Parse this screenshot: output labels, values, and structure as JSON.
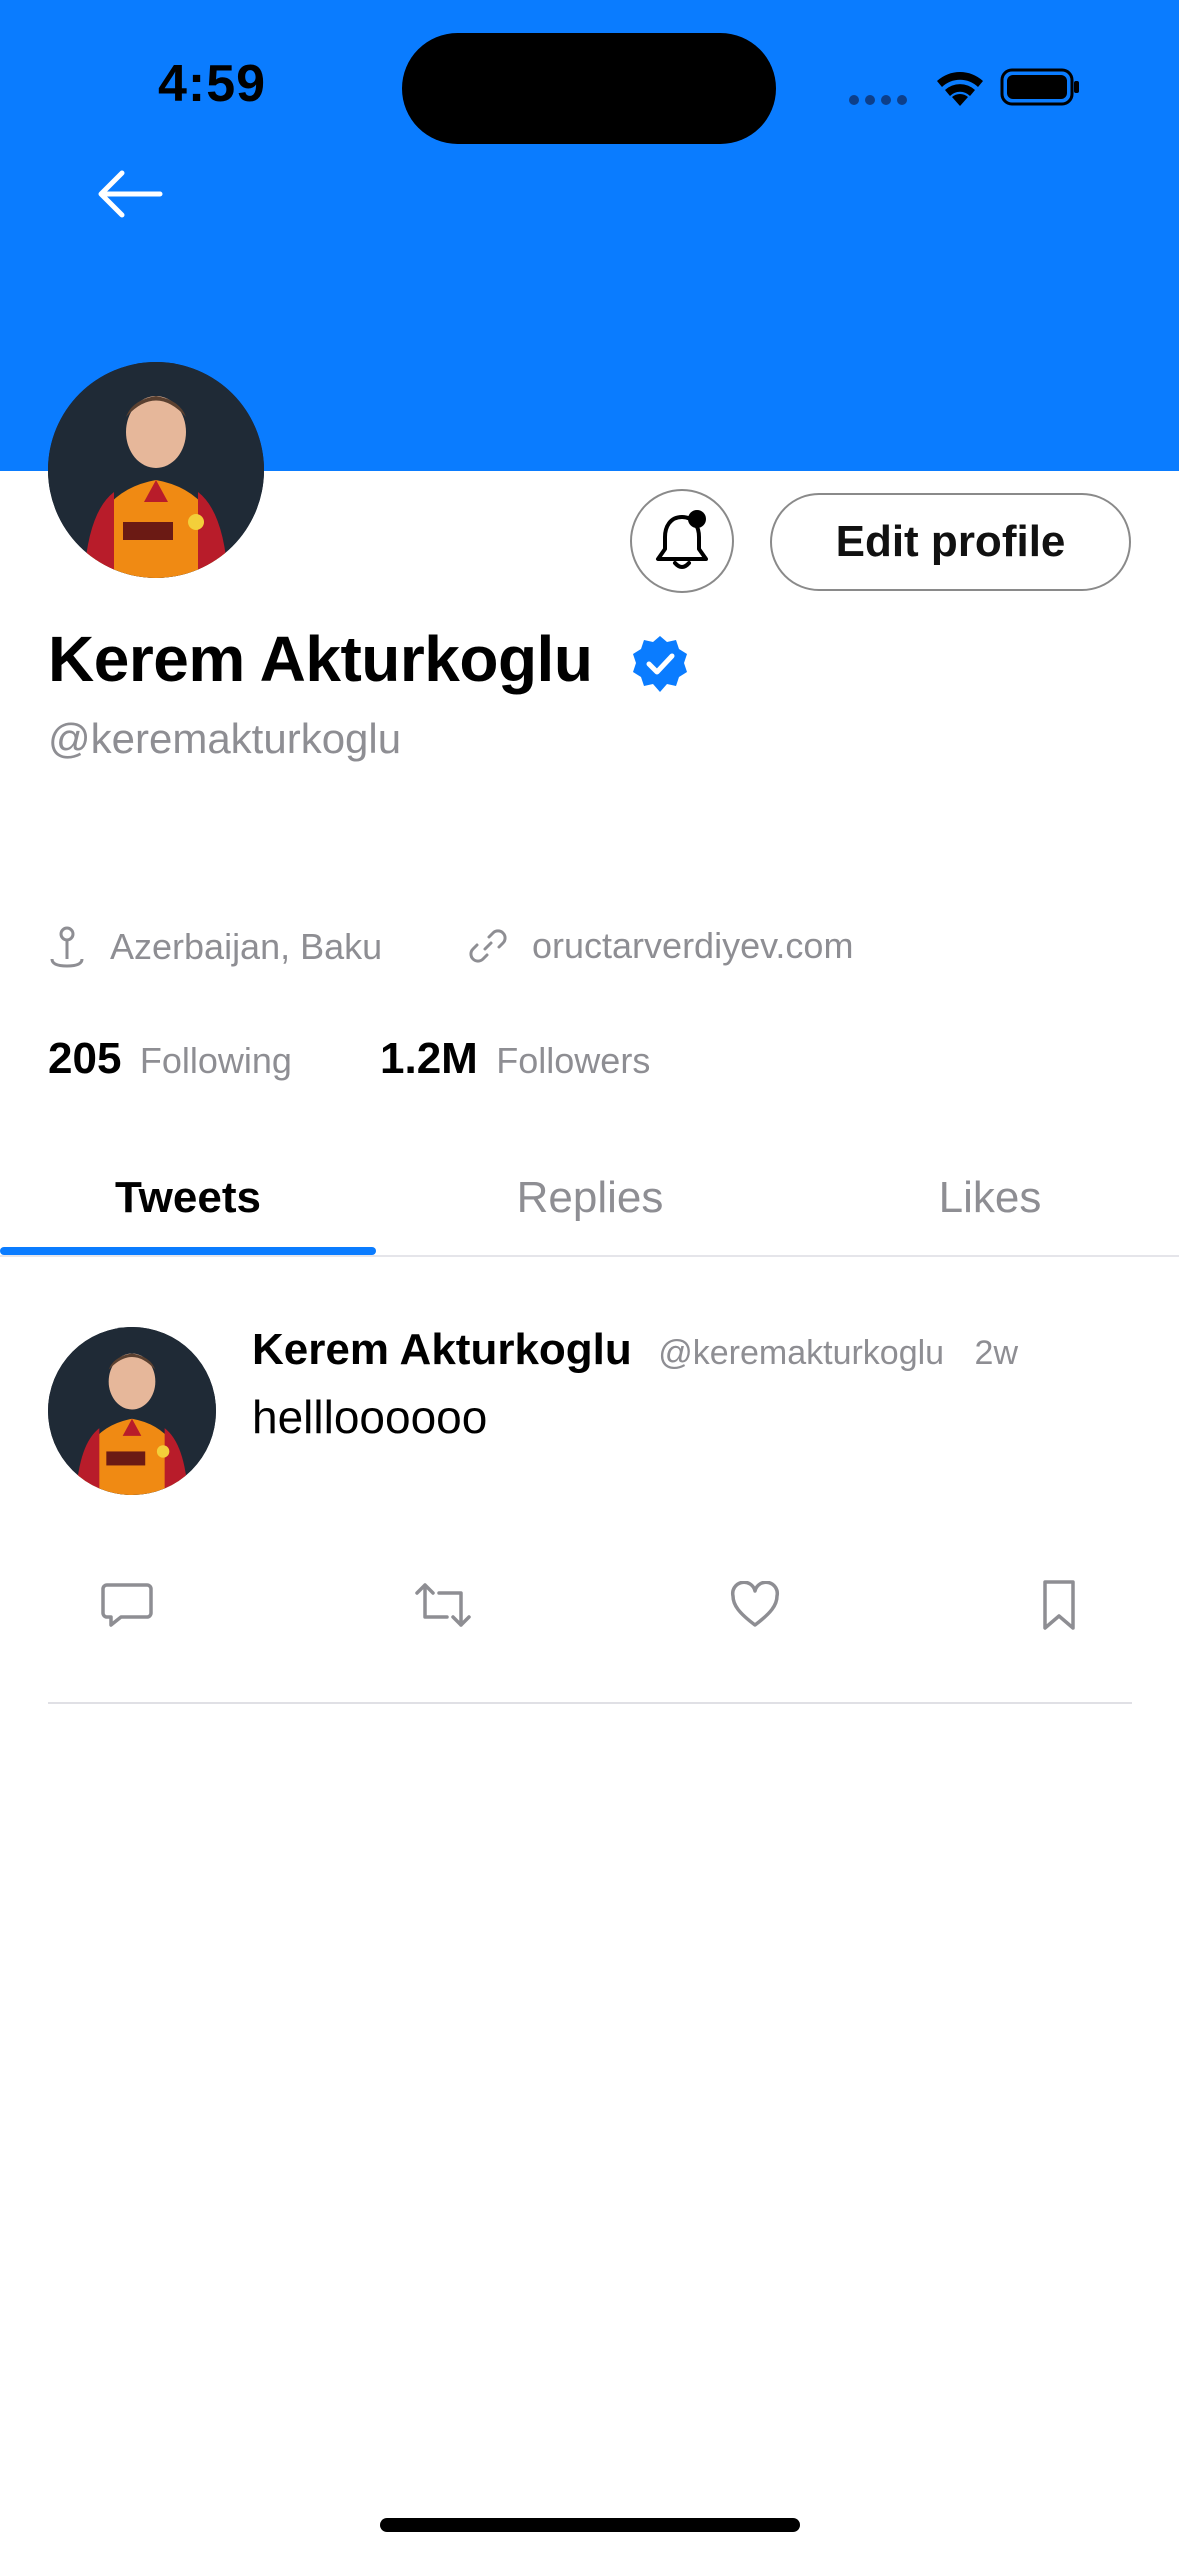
{
  "status_bar": {
    "time": "4:59"
  },
  "header": {
    "banner_color": "#0a7cff",
    "back_icon": "arrow-left-icon"
  },
  "profile": {
    "name": "Kerem Akturkoglu",
    "handle": "@keremakturkoglu",
    "verified": true,
    "edit_label": "Edit profile",
    "location": "Azerbaijan, Baku",
    "website": "oructarverdiyev.com",
    "following_count": "205",
    "following_label": "Following",
    "followers_count": "1.2M",
    "followers_label": "Followers"
  },
  "tabs": [
    {
      "label": "Tweets",
      "active": true
    },
    {
      "label": "Replies",
      "active": false
    },
    {
      "label": "Likes",
      "active": false
    }
  ],
  "tweets": [
    {
      "name": "Kerem Akturkoglu",
      "handle": "@keremakturkoglu",
      "time": "2w",
      "text": "hellloooooo",
      "actions": [
        "comment-icon",
        "retweet-icon",
        "heart-icon",
        "bookmark-icon"
      ]
    }
  ],
  "colors": {
    "accent": "#0a7cff",
    "secondary_text": "#8e8e93"
  }
}
